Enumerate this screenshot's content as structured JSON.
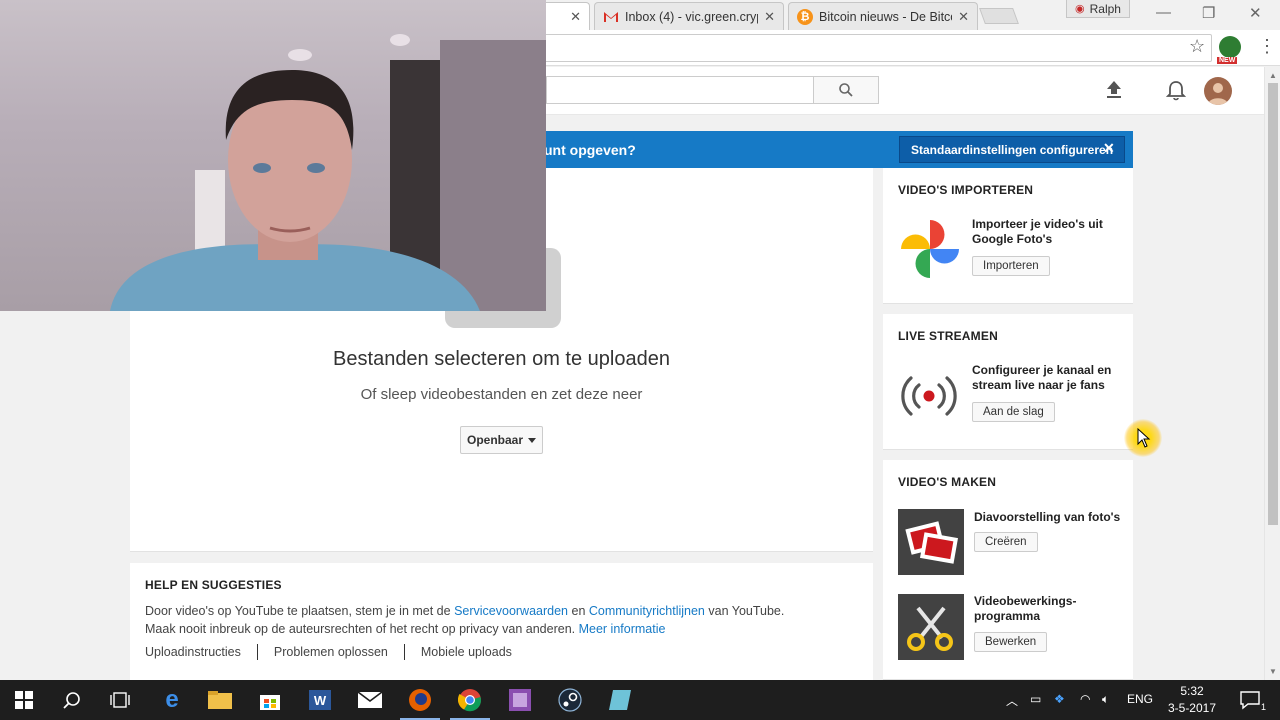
{
  "browser": {
    "tabs": [
      {
        "title": "Inbox (4) - vic.green.cryp",
        "icon": "gmail-icon"
      },
      {
        "title": "Bitcoin nieuws - De Bitco",
        "icon": "bitcoin-icon"
      }
    ],
    "profile_name": "Ralph",
    "extension_badge": "NEW"
  },
  "youtube": {
    "notice": {
      "question": "unt opgeven?",
      "configure_button": "Standaardinstellingen configureren",
      "close": "✕"
    },
    "upload": {
      "title": "Bestanden selecteren om te uploaden",
      "subtitle": "Of sleep videobestanden en zet deze neer",
      "privacy_value": "Openbaar"
    },
    "help": {
      "heading": "HELP EN SUGGESTIES",
      "line1_a": "Door video's op YouTube te plaatsen, stem je in met de ",
      "link_terms": "Servicevoorwaarden",
      "line1_b": " en ",
      "link_guidelines": "Communityrichtlijnen",
      "line1_c": " van YouTube.",
      "line2_a": "Maak nooit inbreuk op de auteursrechten of het recht op privacy van anderen. ",
      "link_more": "Meer informatie",
      "links": [
        "Uploadinstructies",
        "Problemen oplossen",
        "Mobiele uploads"
      ]
    },
    "sidebar": {
      "import": {
        "heading": "VIDEO'S IMPORTEREN",
        "text": "Importeer je video's uit Google Foto's",
        "button": "Importeren"
      },
      "live": {
        "heading": "LIVE STREAMEN",
        "text": "Configureer je kanaal en stream live naar je fans",
        "button": "Aan de slag"
      },
      "create": {
        "heading": "VIDEO'S MAKEN",
        "slideshow_text": "Diavoorstelling van foto's",
        "slideshow_button": "Creëren",
        "editor_text": "Videobewerkings-programma",
        "editor_button": "Bewerken"
      }
    }
  },
  "taskbar": {
    "language": "ENG",
    "time": "5:32",
    "date": "3-5-2017",
    "notification_count": "1"
  }
}
